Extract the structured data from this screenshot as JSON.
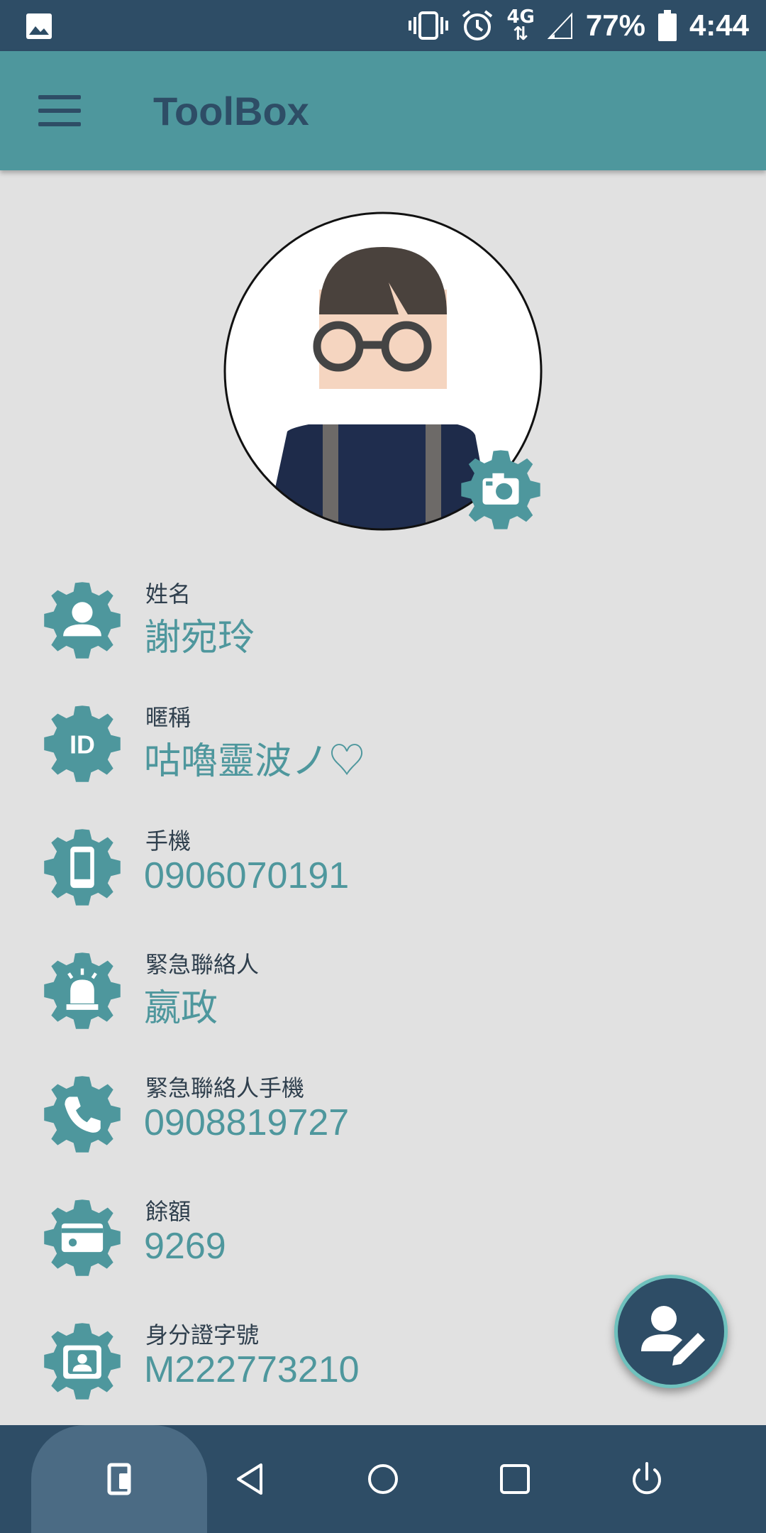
{
  "status_bar": {
    "battery_text": "77%",
    "time": "4:44",
    "network": "4G",
    "icons": [
      "image-icon",
      "vibrate-icon",
      "alarm-icon",
      "network-4g-icon",
      "signal-icon",
      "battery-icon"
    ]
  },
  "app_bar": {
    "title": "ToolBox",
    "menu_icon": "hamburger-menu-icon"
  },
  "profile": {
    "fields": [
      {
        "label": "姓名",
        "value": "謝宛玲",
        "icon": "person-gear-icon"
      },
      {
        "label": "暱稱",
        "value": "咕嚕靈波ノ♡",
        "icon": "id-gear-icon"
      },
      {
        "label": "手機",
        "value": "0906070191",
        "icon": "phone-gear-icon"
      },
      {
        "label": "緊急聯絡人",
        "value": "嬴政",
        "icon": "alarm-light-gear-icon"
      },
      {
        "label": "緊急聯絡人手機",
        "value": "0908819727",
        "icon": "call-gear-icon"
      },
      {
        "label": "餘額",
        "value": "9269",
        "icon": "card-gear-icon"
      },
      {
        "label": "身分證字號",
        "value": "M222773210",
        "icon": "id-card-gear-icon"
      }
    ]
  },
  "fab": {
    "icon": "edit-profile-icon"
  },
  "nav_bar": {
    "icons": [
      "screen-pin-icon",
      "back-icon",
      "home-icon",
      "recents-icon",
      "power-icon"
    ]
  },
  "colors": {
    "status_bar": "#2e4d66",
    "app_bar": "#4e979d",
    "accent": "#4e979d",
    "background": "#e1e1e1",
    "fab": "#2e4d66",
    "fab_ring": "#6fc1bd"
  }
}
